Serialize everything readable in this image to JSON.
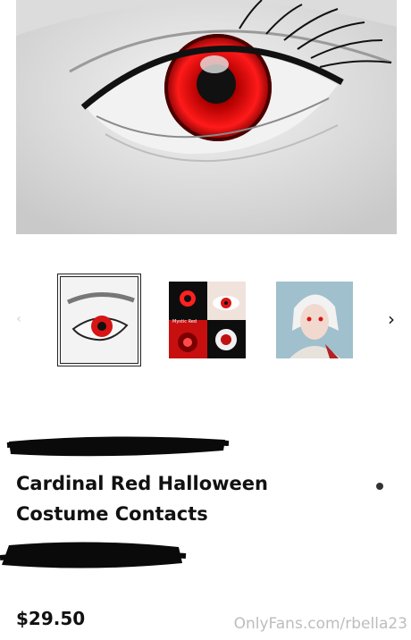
{
  "product": {
    "title_line1": "Cardinal Red Halloween",
    "title_line2": "Costume Contacts",
    "price": "$29.50"
  },
  "gallery": {
    "prev_icon": "‹",
    "next_icon": "›",
    "thumbnails": [
      {
        "label": ""
      },
      {
        "label": "Mystic Red"
      },
      {
        "label": ""
      }
    ],
    "selected_index": 0
  },
  "watermark": "OnlyFans.com/rbella23",
  "colors": {
    "accent_red": "#d81414",
    "text": "#111111",
    "watermark": "#bdbdbd"
  }
}
